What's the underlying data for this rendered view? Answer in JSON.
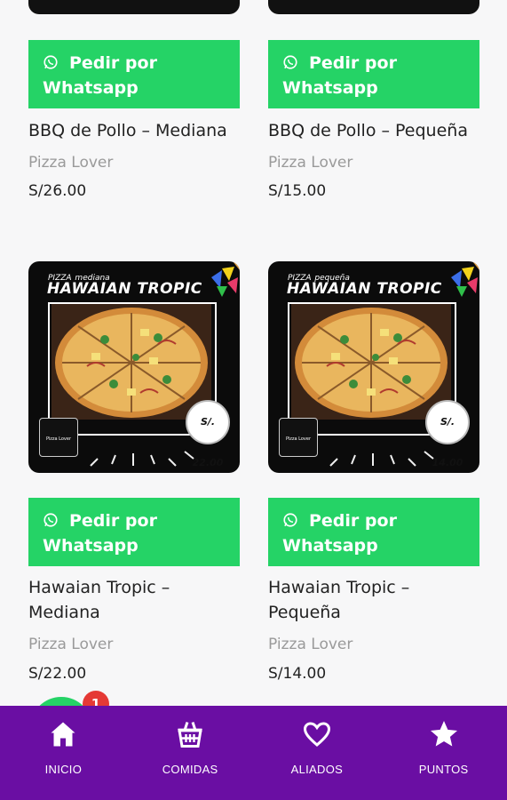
{
  "products_top": [
    {
      "button_line1": "Pedir por",
      "button_line2": "Whatsapp",
      "title": "BBQ de Pollo – Mediana",
      "store": "Pizza Lover",
      "price": "S/26.00"
    },
    {
      "button_line1": "Pedir por",
      "button_line2": "Whatsapp",
      "title": "BBQ de Pollo – Pequeña",
      "store": "Pizza Lover",
      "price": "S/15.00"
    }
  ],
  "products_bottom": [
    {
      "image": {
        "prefix": "PIZZA",
        "size_word": "mediana",
        "name": "HAWAIAN TROPIC",
        "price_badge": "S/. 22.00"
      },
      "button_line1": "Pedir por",
      "button_line2": "Whatsapp",
      "title_line1": "Hawaian Tropic –",
      "title_line2": "Mediana",
      "store": "Pizza Lover",
      "price": "S/22.00"
    },
    {
      "image": {
        "prefix": "PIZZA",
        "size_word": "pequeña",
        "name": "HAWAIAN TROPIC",
        "price_badge": "S/. 14.00"
      },
      "button_line1": "Pedir por",
      "button_line2": "Whatsapp",
      "title_line1": "Hawaian Tropic –",
      "title_line2": "Pequeña",
      "store": "Pizza Lover",
      "price": "S/14.00"
    }
  ],
  "fab": {
    "badge": "1"
  },
  "nav": [
    {
      "label": "INICIO",
      "icon": "home-icon"
    },
    {
      "label": "COMIDAS",
      "icon": "basket-icon"
    },
    {
      "label": "ALIADOS",
      "icon": "heart-icon"
    },
    {
      "label": "PUNTOS",
      "icon": "star-icon"
    }
  ],
  "colors": {
    "whatsapp_green": "#25d366",
    "nav_purple": "#6a0ea3",
    "badge_red": "#e53935"
  }
}
